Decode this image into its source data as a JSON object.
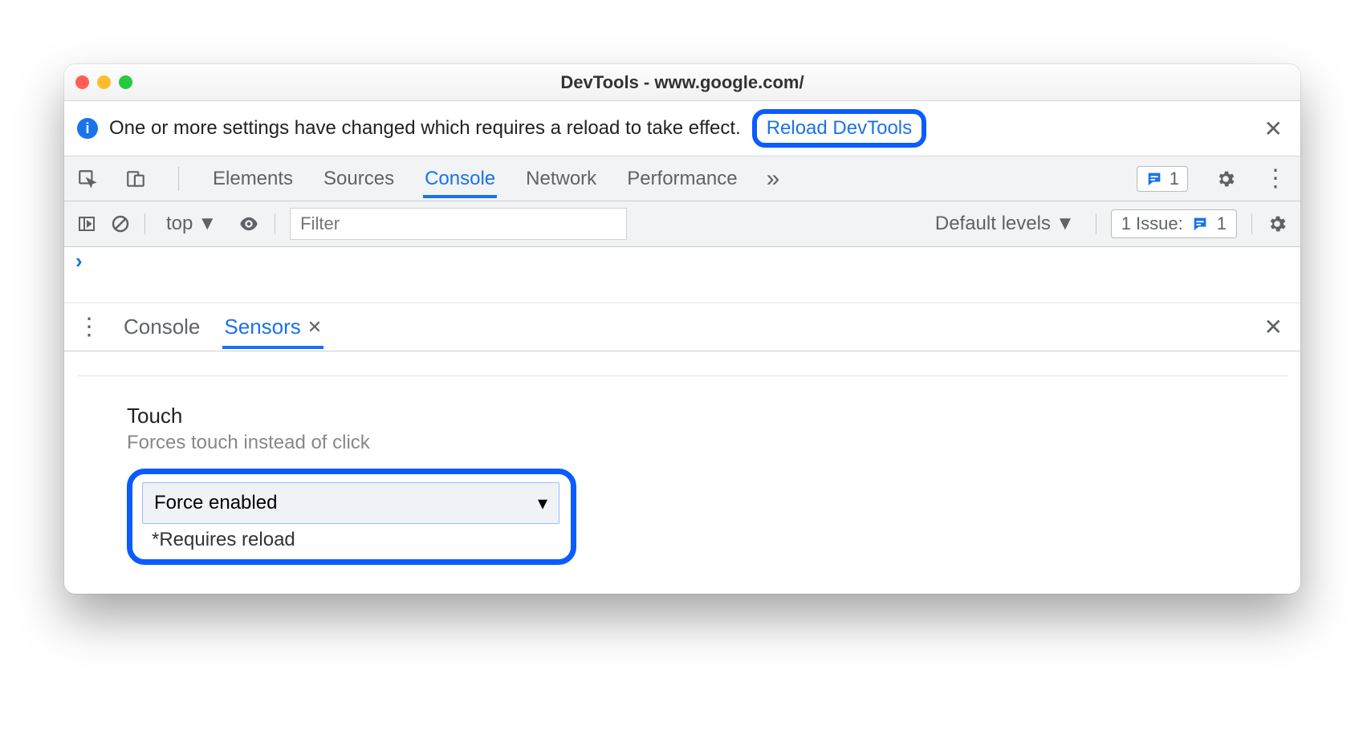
{
  "window": {
    "title": "DevTools - www.google.com/"
  },
  "infobar": {
    "message": "One or more settings have changed which requires a reload to take effect.",
    "reload_label": "Reload DevTools"
  },
  "tabs": {
    "items": [
      "Elements",
      "Sources",
      "Console",
      "Network",
      "Performance"
    ],
    "active": "Console",
    "chip_count": "1"
  },
  "console_toolbar": {
    "context": "top",
    "filter_placeholder": "Filter",
    "levels": "Default levels",
    "issues_label": "1 Issue:",
    "issues_count": "1"
  },
  "drawer": {
    "tabs": [
      "Console",
      "Sensors"
    ],
    "active": "Sensors"
  },
  "sensors": {
    "touch_label": "Touch",
    "touch_sub": "Forces touch instead of click",
    "select_value": "Force enabled",
    "requires": "*Requires reload"
  }
}
